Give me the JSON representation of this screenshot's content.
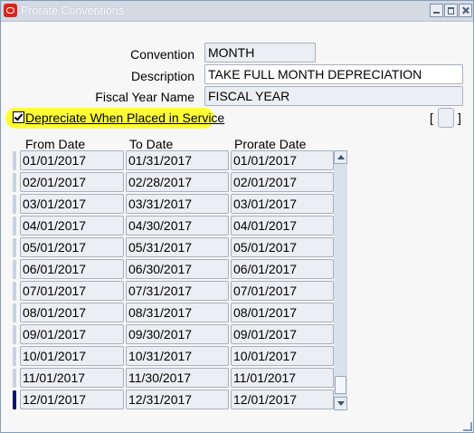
{
  "window": {
    "title": "Prorate Conventions",
    "colors": {
      "titlebar": "#d4d9e3",
      "highlight": "#ffff33",
      "logo": "#d8261c"
    },
    "icons": {
      "logo": "oracle-logo-icon",
      "minimize": "minimize-icon",
      "maximize": "maximize-icon",
      "close": "close-icon"
    }
  },
  "form": {
    "convention_label": "Convention",
    "convention_value": "MONTH",
    "description_label": "Description",
    "description_value": "TAKE FULL MONTH DEPRECIATION",
    "fiscal_year_label": "Fiscal Year Name",
    "fiscal_year_value": "FISCAL YEAR",
    "depreciate_label": "Depreciate When Placed in Service",
    "depreciate_checked": true,
    "dff_open": "[",
    "dff_close": "]"
  },
  "table": {
    "headers": [
      "From Date",
      "To Date",
      "Prorate Date"
    ],
    "active_row": 11,
    "rows": [
      [
        "01/01/2017",
        "01/31/2017",
        "01/01/2017"
      ],
      [
        "02/01/2017",
        "02/28/2017",
        "02/01/2017"
      ],
      [
        "03/01/2017",
        "03/31/2017",
        "03/01/2017"
      ],
      [
        "04/01/2017",
        "04/30/2017",
        "04/01/2017"
      ],
      [
        "05/01/2017",
        "05/31/2017",
        "05/01/2017"
      ],
      [
        "06/01/2017",
        "06/30/2017",
        "06/01/2017"
      ],
      [
        "07/01/2017",
        "07/31/2017",
        "07/01/2017"
      ],
      [
        "08/01/2017",
        "08/31/2017",
        "08/01/2017"
      ],
      [
        "09/01/2017",
        "09/30/2017",
        "09/01/2017"
      ],
      [
        "10/01/2017",
        "10/31/2017",
        "10/01/2017"
      ],
      [
        "11/01/2017",
        "11/30/2017",
        "11/01/2017"
      ],
      [
        "12/01/2017",
        "12/31/2017",
        "12/01/2017"
      ]
    ]
  }
}
